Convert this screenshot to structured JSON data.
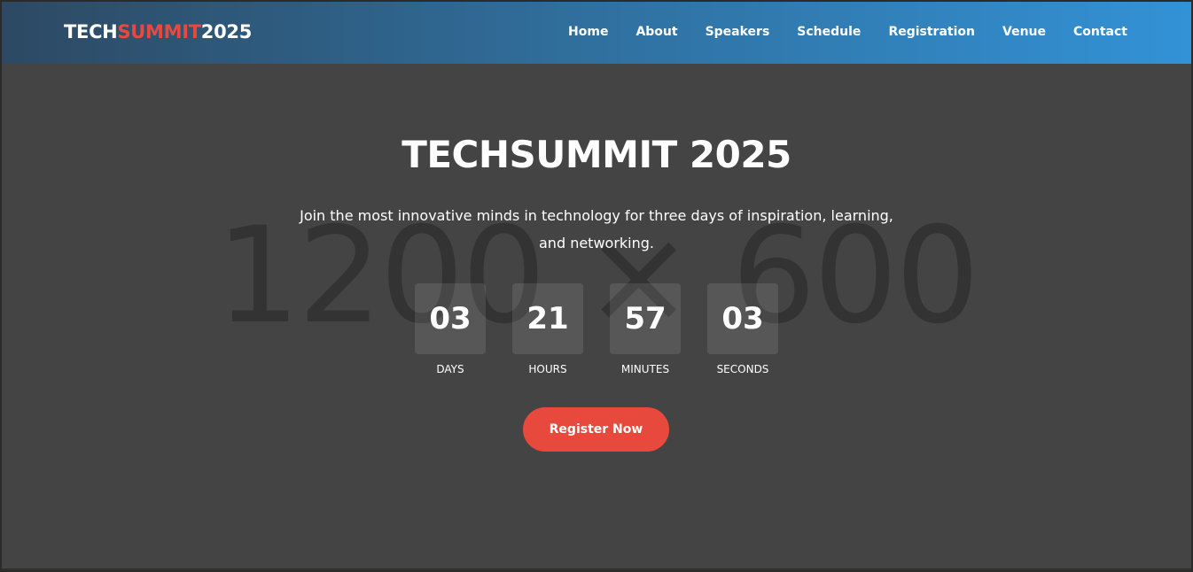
{
  "brand": {
    "logo_part1": "TECH",
    "logo_part2": "SUMMIT",
    "logo_part3": "2025",
    "accent_color": "#e8493d"
  },
  "nav": {
    "items": [
      {
        "label": "Home"
      },
      {
        "label": "About"
      },
      {
        "label": "Speakers"
      },
      {
        "label": "Schedule"
      },
      {
        "label": "Registration"
      },
      {
        "label": "Venue"
      },
      {
        "label": "Contact"
      }
    ]
  },
  "hero": {
    "placeholder": "1200 × 600",
    "title": "TECHSUMMIT 2025",
    "subtitle_line1": "Join the most innovative minds in technology for three days of inspiration, learning,",
    "subtitle_line2": "and networking.",
    "countdown": [
      {
        "value": "03",
        "label": "DAYS"
      },
      {
        "value": "21",
        "label": "HOURS"
      },
      {
        "value": "57",
        "label": "MINUTES"
      },
      {
        "value": "03",
        "label": "SECONDS"
      }
    ],
    "cta_label": "Register Now"
  }
}
